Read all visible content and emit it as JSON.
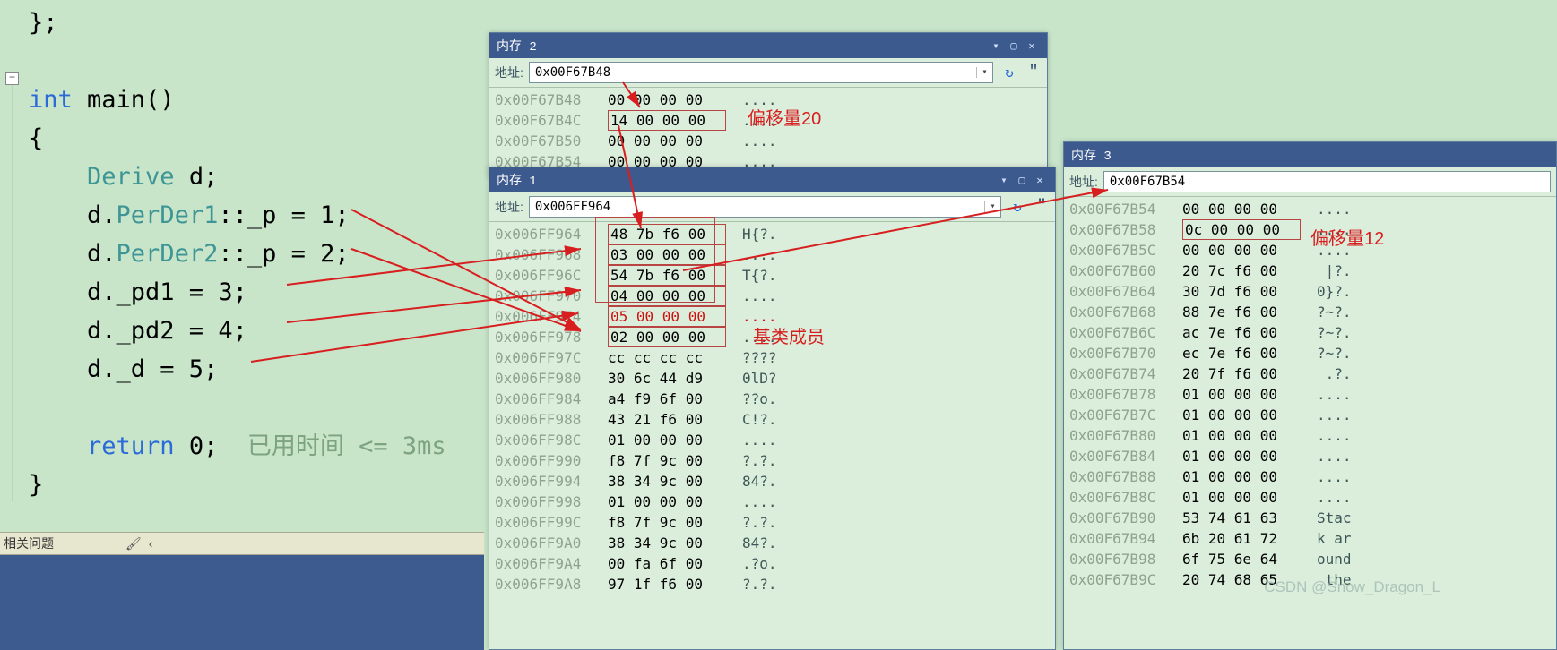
{
  "code": {
    "l0": "};",
    "l1_kw": "int",
    "l1_fn": " main",
    "l1_rest": "()",
    "l2": "{",
    "l3_type": "    Derive",
    "l3_rest": " d;",
    "l4_a": "    d.",
    "l4_b": "PerDer1",
    "l4_c": "::_p = 1;",
    "l5_a": "    d.",
    "l5_b": "PerDer2",
    "l5_c": "::_p = 2;",
    "l6": "    d._pd1 = 3;",
    "l7": "    d._pd2 = 4;",
    "l8": "    d._d = 5;",
    "l9_kw": "    return",
    "l9_rest": " 0; ",
    "l9_cm": " 已用时间 <= 3ms",
    "l10": "}"
  },
  "mem2": {
    "title": "内存 2",
    "addr_label": "地址:",
    "addr_value": "0x00F67B48",
    "rows": [
      {
        "addr": "0x00F67B48",
        "hex": "00 00 00 00",
        "ascii": "...."
      },
      {
        "addr": "0x00F67B4C",
        "hex": "14 00 00 00",
        "ascii": "...."
      },
      {
        "addr": "0x00F67B50",
        "hex": "00 00 00 00",
        "ascii": "...."
      },
      {
        "addr": "0x00F67B54",
        "hex": "00 00 00 00",
        "ascii": "...."
      }
    ]
  },
  "mem1": {
    "title": "内存 1",
    "addr_label": "地址:",
    "addr_value": "0x006FF964",
    "rows": [
      {
        "addr": "0x006FF964",
        "hex": "48 7b f6 00",
        "ascii": "H{?."
      },
      {
        "addr": "0x006FF968",
        "hex": "03 00 00 00",
        "ascii": "...."
      },
      {
        "addr": "0x006FF96C",
        "hex": "54 7b f6 00",
        "ascii": "T{?."
      },
      {
        "addr": "0x006FF970",
        "hex": "04 00 00 00",
        "ascii": "...."
      },
      {
        "addr": "0x006FF974",
        "hex": "05 00 00 00",
        "ascii": "....",
        "red": true
      },
      {
        "addr": "0x006FF978",
        "hex": "02 00 00 00",
        "ascii": "...."
      },
      {
        "addr": "0x006FF97C",
        "hex": "cc cc cc cc",
        "ascii": "????"
      },
      {
        "addr": "0x006FF980",
        "hex": "30 6c 44 d9",
        "ascii": "0lD?"
      },
      {
        "addr": "0x006FF984",
        "hex": "a4 f9 6f 00",
        "ascii": "??o."
      },
      {
        "addr": "0x006FF988",
        "hex": "43 21 f6 00",
        "ascii": "C!?."
      },
      {
        "addr": "0x006FF98C",
        "hex": "01 00 00 00",
        "ascii": "...."
      },
      {
        "addr": "0x006FF990",
        "hex": "f8 7f 9c 00",
        "ascii": "?.?."
      },
      {
        "addr": "0x006FF994",
        "hex": "38 34 9c 00",
        "ascii": "84?."
      },
      {
        "addr": "0x006FF998",
        "hex": "01 00 00 00",
        "ascii": "...."
      },
      {
        "addr": "0x006FF99C",
        "hex": "f8 7f 9c 00",
        "ascii": "?.?."
      },
      {
        "addr": "0x006FF9A0",
        "hex": "38 34 9c 00",
        "ascii": "84?."
      },
      {
        "addr": "0x006FF9A4",
        "hex": "00 fa 6f 00",
        "ascii": ".?o."
      },
      {
        "addr": "0x006FF9A8",
        "hex": "97 1f f6 00",
        "ascii": "?.?."
      }
    ]
  },
  "mem3": {
    "title": "内存 3",
    "addr_label": "地址:",
    "addr_value": "0x00F67B54",
    "rows": [
      {
        "addr": "0x00F67B54",
        "hex": "00 00 00 00",
        "ascii": "...."
      },
      {
        "addr": "0x00F67B58",
        "hex": "0c 00 00 00",
        "ascii": "...."
      },
      {
        "addr": "0x00F67B5C",
        "hex": "00 00 00 00",
        "ascii": "...."
      },
      {
        "addr": "0x00F67B60",
        "hex": "20 7c f6 00",
        "ascii": " |?."
      },
      {
        "addr": "0x00F67B64",
        "hex": "30 7d f6 00",
        "ascii": "0}?."
      },
      {
        "addr": "0x00F67B68",
        "hex": "88 7e f6 00",
        "ascii": "?~?."
      },
      {
        "addr": "0x00F67B6C",
        "hex": "ac 7e f6 00",
        "ascii": "?~?."
      },
      {
        "addr": "0x00F67B70",
        "hex": "ec 7e f6 00",
        "ascii": "?~?."
      },
      {
        "addr": "0x00F67B74",
        "hex": "20 7f f6 00",
        "ascii": " .?."
      },
      {
        "addr": "0x00F67B78",
        "hex": "01 00 00 00",
        "ascii": "...."
      },
      {
        "addr": "0x00F67B7C",
        "hex": "01 00 00 00",
        "ascii": "...."
      },
      {
        "addr": "0x00F67B80",
        "hex": "01 00 00 00",
        "ascii": "...."
      },
      {
        "addr": "0x00F67B84",
        "hex": "01 00 00 00",
        "ascii": "...."
      },
      {
        "addr": "0x00F67B88",
        "hex": "01 00 00 00",
        "ascii": "...."
      },
      {
        "addr": "0x00F67B8C",
        "hex": "01 00 00 00",
        "ascii": "...."
      },
      {
        "addr": "0x00F67B90",
        "hex": "53 74 61 63",
        "ascii": "Stac"
      },
      {
        "addr": "0x00F67B94",
        "hex": "6b 20 61 72",
        "ascii": "k ar"
      },
      {
        "addr": "0x00F67B98",
        "hex": "6f 75 6e 64",
        "ascii": "ound"
      },
      {
        "addr": "0x00F67B9C",
        "hex": "20 74 68 65",
        "ascii": " the"
      }
    ]
  },
  "annotations": {
    "offset20": "偏移量20",
    "baseclass": "基类成员",
    "offset12": "偏移量12"
  },
  "bottom": {
    "label": "相关问题"
  },
  "watermark": "CSDN @Snow_Dragon_L"
}
